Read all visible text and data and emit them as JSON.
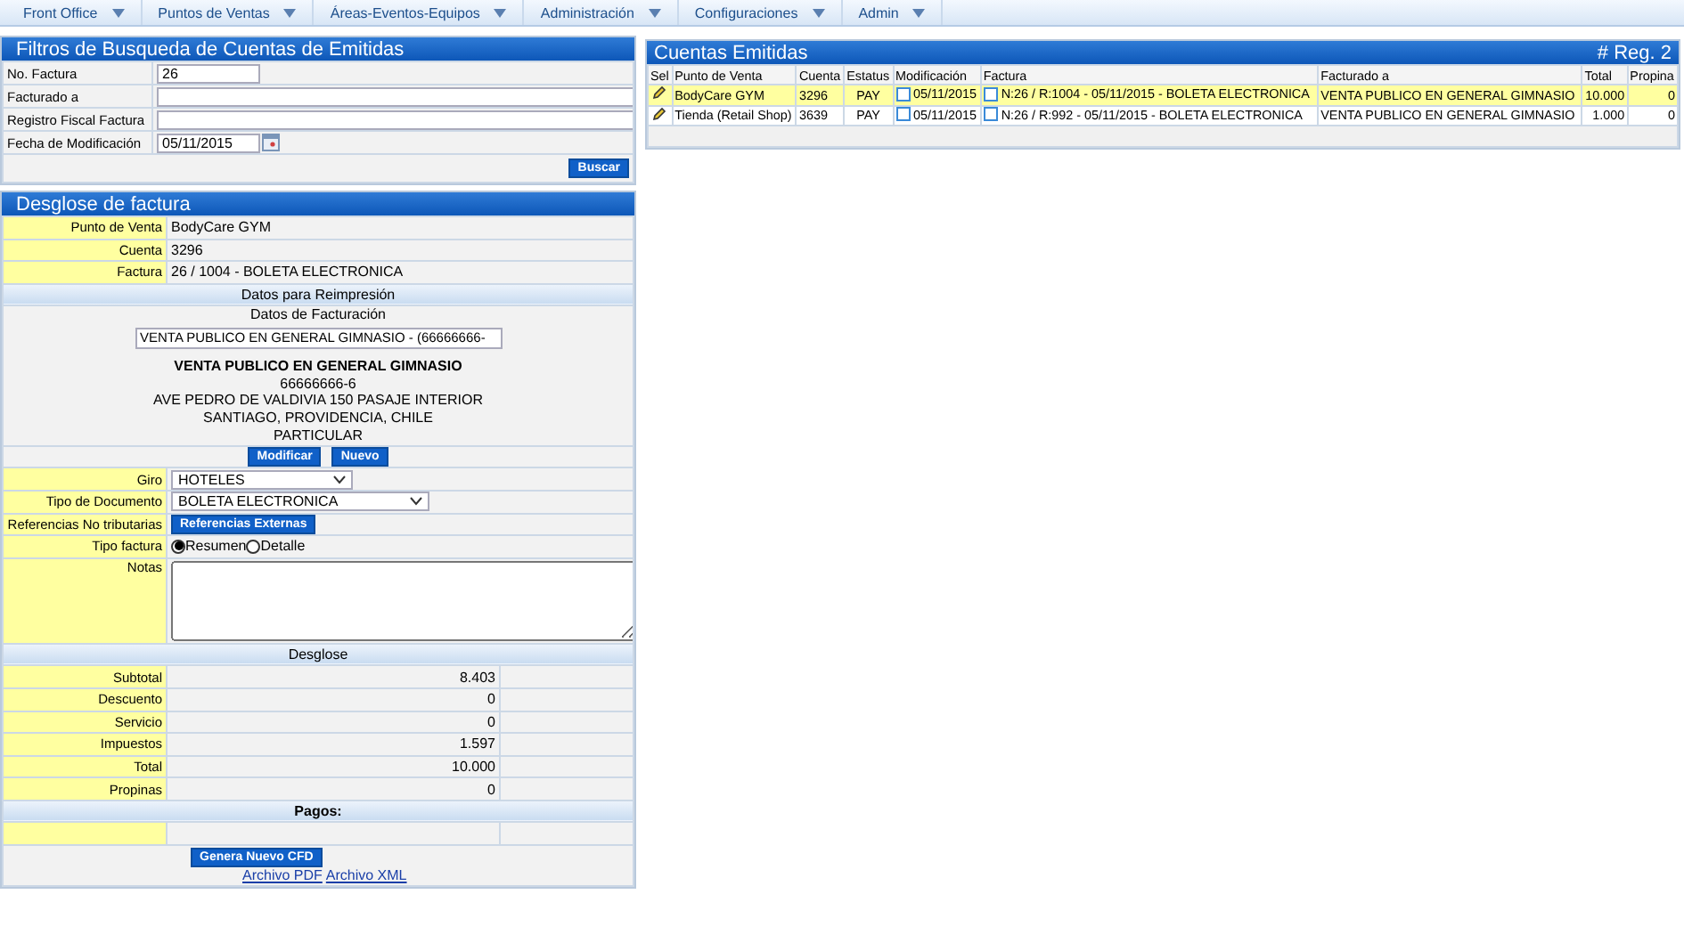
{
  "menu": [
    {
      "label": "Front Office"
    },
    {
      "label": "Puntos de Ventas"
    },
    {
      "label": "Áreas-Eventos-Equipos"
    },
    {
      "label": "Administración"
    },
    {
      "label": "Configuraciones"
    },
    {
      "label": "Admin"
    }
  ],
  "filters": {
    "title": "Filtros de Busqueda de Cuentas de Emitidas",
    "fields": [
      {
        "label": "No. Factura",
        "value": "26",
        "kind": "short"
      },
      {
        "label": "Facturado a",
        "kind": "text"
      },
      {
        "label": "Registro Fiscal Factura",
        "kind": "text"
      },
      {
        "label": "Fecha de Modificación",
        "value": "05/11/2015",
        "kind": "date"
      }
    ],
    "button": "Buscar"
  },
  "accounts": {
    "title": "Cuentas Emitidas",
    "count_label": "# Reg.",
    "count": "2",
    "columns": [
      "Sel",
      "Punto de Venta",
      "Cuenta",
      "Estatus",
      "Modificación",
      "Factura",
      "Facturado a",
      "Total",
      "Propina"
    ],
    "rows": [
      {
        "selected": true,
        "punto": "BodyCare GYM",
        "cuenta": "3296",
        "estatus": "PAY",
        "modificacion": "05/11/2015",
        "factura": "N:26 / R:1004 - 05/11/2015 - BOLETA ELECTRONICA",
        "facturado": "VENTA PUBLICO EN GENERAL GIMNASIO",
        "total": "10.000",
        "propina": "0"
      },
      {
        "selected": false,
        "punto": "Tienda (Retail Shop)",
        "cuenta": "3639",
        "estatus": "PAY",
        "modificacion": "05/11/2015",
        "factura": "N:26 / R:992 - 05/11/2015 - BOLETA ELECTRONICA",
        "facturado": "VENTA PUBLICO EN GENERAL GIMNASIO",
        "total": "1.000",
        "propina": "0"
      }
    ]
  },
  "detail": {
    "title": "Desglose de factura",
    "info": [
      {
        "label": "Punto de Venta",
        "value": "BodyCare GYM"
      },
      {
        "label": "Cuenta",
        "value": "3296"
      },
      {
        "label": "Factura",
        "value": "26 / 1004 - BOLETA ELECTRONICA"
      }
    ],
    "reprint_header": "Datos para Reimpresión",
    "billing_header": "Datos de Facturación",
    "billing_select": "VENTA PUBLICO EN GENERAL GIMNASIO  - (66666666-",
    "billing_name": "VENTA PUBLICO EN GENERAL GIMNASIO",
    "billing_lines": [
      "66666666-6",
      "AVE PEDRO DE VALDIVIA 150 PASAJE INTERIOR",
      "SANTIAGO, PROVIDENCIA, CHILE",
      "PARTICULAR"
    ],
    "buttons": [
      "Modificar",
      "Nuevo"
    ],
    "giro": {
      "label": "Giro",
      "value": "HOTELES"
    },
    "tipo_documento": {
      "label": "Tipo de Documento",
      "value": "BOLETA ELECTRONICA"
    },
    "referencias": {
      "label": "Referencias No tributarias",
      "button": "Referencias Externas"
    },
    "tipo_factura": {
      "label": "Tipo factura",
      "options": [
        {
          "label": "Resumen",
          "selected": true
        },
        {
          "label": "Detalle",
          "selected": false
        }
      ]
    },
    "notas": {
      "label": "Notas"
    },
    "desglose_header": "Desglose",
    "totals": [
      {
        "label": "Subtotal",
        "value": "8.403"
      },
      {
        "label": "Descuento",
        "value": "0"
      },
      {
        "label": "Servicio",
        "value": "0"
      },
      {
        "label": "Impuestos",
        "value": "1.597"
      },
      {
        "label": "Total",
        "value": "10.000"
      },
      {
        "label": "Propinas",
        "value": "0"
      }
    ],
    "pagos_header": "Pagos:",
    "generate_button": "Genera Nuevo CFD",
    "links": [
      "Archivo PDF",
      "Archivo XML"
    ]
  }
}
